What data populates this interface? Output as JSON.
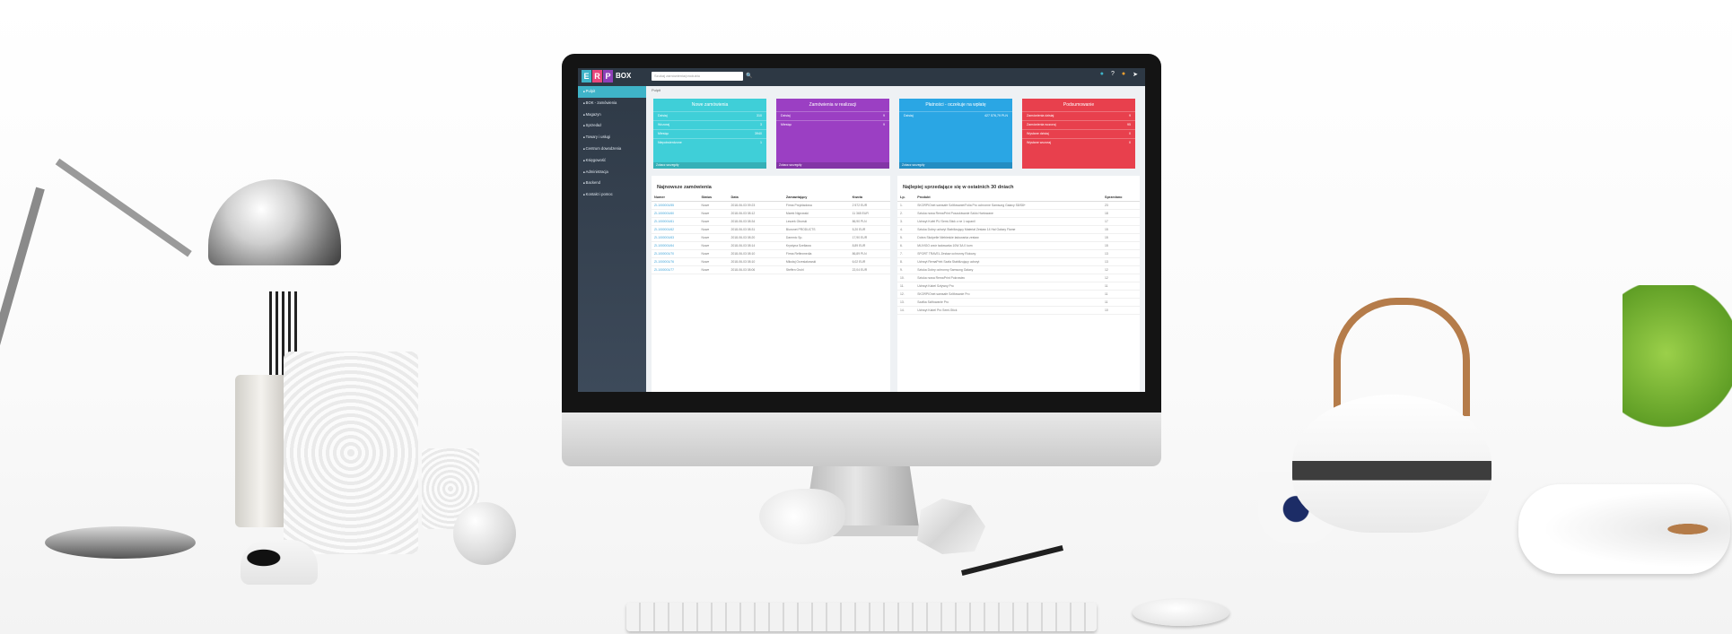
{
  "app": {
    "logo_letters": [
      "E",
      "R",
      "P"
    ],
    "logo_suffix": "BOX",
    "logo_colors": [
      "#3fb3c8",
      "#e8467c",
      "#8f3fb8"
    ],
    "search_placeholder": "Szukaj zamówienia/produktu",
    "top_icons": [
      "chat-icon",
      "help-icon",
      "user-icon",
      "logout-icon"
    ]
  },
  "sidebar": {
    "items": [
      {
        "label": "Pulpit",
        "icon": "home-icon",
        "active": true
      },
      {
        "label": "BOK - zamówienia",
        "icon": "cart-icon"
      },
      {
        "label": "Magazyn",
        "icon": "box-icon"
      },
      {
        "label": "Sprzedaż",
        "icon": "tag-icon"
      },
      {
        "label": "Towary i usługi",
        "icon": "list-icon"
      },
      {
        "label": "Centrum dowodzenia",
        "icon": "dashboard-icon"
      },
      {
        "label": "Księgowość",
        "icon": "book-icon"
      },
      {
        "label": "Administracja",
        "icon": "gear-icon"
      },
      {
        "label": "Backend",
        "icon": "code-icon"
      },
      {
        "label": "Kontakt i pomoc",
        "icon": "help-icon"
      }
    ]
  },
  "breadcrumb": "Pulpit",
  "tiles": [
    {
      "title": "Nowe zamówienia",
      "color": "#3fcfd8",
      "rows": [
        [
          "Dzisiaj",
          "310"
        ],
        [
          "Wczoraj",
          "3"
        ],
        [
          "Miesiąc",
          "3940"
        ],
        [
          "Niepotwierdzone",
          "1"
        ]
      ],
      "footer": "Zobacz szczegóły"
    },
    {
      "title": "Zamówienia w realizacji",
      "color": "#9b3fc3",
      "rows": [
        [
          "Dzisiaj",
          "9"
        ],
        [
          "Miesiąc",
          "9"
        ]
      ],
      "footer": "Zobacz szczegóły"
    },
    {
      "title": "Płatności - oczekuje na wpłatę",
      "color": "#2aa6e4",
      "rows": [
        [
          "Dzisiaj",
          "427 576,79 PLN"
        ]
      ],
      "footer": "Zobacz szczegóły"
    },
    {
      "title": "Podsumowanie",
      "color": "#e8404d",
      "rows": [
        [
          "Zamówienia dzisiaj",
          "9"
        ],
        [
          "Zamówienia wczoraj",
          "95"
        ],
        [
          "Wysłane dzisiaj",
          "0"
        ],
        [
          "Wysłane wczoraj",
          "0"
        ]
      ],
      "footer": ""
    }
  ],
  "orders": {
    "title": "Najnowsze zamówienia",
    "columns": [
      "Numer",
      "Status",
      "Data",
      "Zamawiający",
      "Kwota"
    ],
    "rows": [
      [
        "ZI-1000001/55",
        "Nowe",
        "2018-06-03 09:23",
        "Firma Przykładowa",
        "2 572 EUR"
      ],
      [
        "ZI-1000001/60",
        "Nowe",
        "2018-06-03 08:12",
        "Marek Nigrowski",
        "11 365 EUR"
      ],
      [
        "ZI-1000001/61",
        "Nowe",
        "2018-06-03 08:34",
        "Leszek Oborski",
        "86,90 PLN"
      ],
      [
        "ZI-1000001/62",
        "Nowe",
        "2018-06-03 08:31",
        "Biuronet PRODUCTS",
        "5,20 EUR"
      ],
      [
        "ZI-1000001/63",
        "Nowe",
        "2018-06-03 08:20",
        "Dammic Sp.",
        "17,90 EUR"
      ],
      [
        "ZI-1000001/64",
        "Nowe",
        "2018-06-03 08:14",
        "Krystyna Szellawa",
        "8,89 EUR"
      ],
      [
        "ZI-1000001/70",
        "Nowe",
        "2018-06-03 08:10",
        "Firma Reflexmedia",
        "86,89 PLN"
      ],
      [
        "ZI-1000001/76",
        "Nowe",
        "2018-06-03 08:10",
        "Mikołaj Grzesiakowski",
        "6,02 EUR"
      ],
      [
        "ZI-1000001/77",
        "Nowe",
        "2018-06-03 08:06",
        "Steffen Gruhl",
        "22,04 EUR"
      ]
    ]
  },
  "bestsellers": {
    "title": "Najlepiej sprzedające się w ostatnich 30 dniach",
    "columns": [
      "Lp.",
      "Produkt",
      "Sprzedano"
    ],
    "rows": [
      [
        "1.",
        "SKORPIOnet samsafe Szlifowanie/Folia Pro ochronne Samsung Galaxy S8/S8+",
        "23"
      ],
      [
        "2.",
        "Sztuka nowa RemaPrint Poszukiwanie Szkło Hartowane",
        "18"
      ],
      [
        "3.",
        "Uchwyt Kufel PU Semi-Stick z ne 1 szpanil",
        "17"
      ],
      [
        "4.",
        "Sztuka Dobry uchwyt Stabilizujący Materiał Zestaw 14 Hal Galaxy Flame",
        "15"
      ],
      [
        "5.",
        "Dobra Skolpelle Niebieskie ładowarka zestaw",
        "15"
      ],
      [
        "6.",
        "MUVIGO wzór ładowarka 10W 3A 0 kom",
        "15"
      ],
      [
        "7.",
        "SPORT TRAVEL Zestaw ochronny Różowy",
        "13"
      ],
      [
        "8.",
        "Uchwyt RemaPrint Szafa Stabilizujący uchwyt",
        "13"
      ],
      [
        "9.",
        "Sztuka Dobry ochronny Samsung Galaxy",
        "12"
      ],
      [
        "10.",
        "Sztuka nowa RemaPrint Pokrowiec",
        "12"
      ],
      [
        "11.",
        "Uchwyt Kabel Sztywny Pro",
        "11"
      ],
      [
        "12.",
        "SKORPIOnet samsafe Szlifowanie Pro",
        "11"
      ],
      [
        "13.",
        "Szafka Szlifowanie Pro",
        "11"
      ],
      [
        "14.",
        "Uchwyt Kabel Pro Semi-Stick",
        "10"
      ]
    ]
  }
}
